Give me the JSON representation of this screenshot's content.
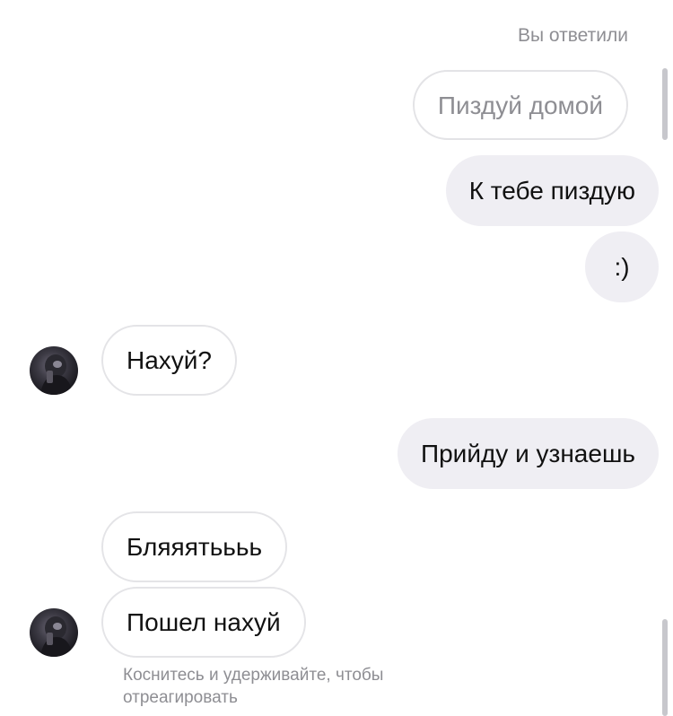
{
  "reply_label": "Вы ответили",
  "messages": [
    {
      "id": "m1",
      "direction": "quoted",
      "text": "Пиздуй домой"
    },
    {
      "id": "m2",
      "direction": "outgoing",
      "text": "К тебе пиздую"
    },
    {
      "id": "m3",
      "direction": "outgoing",
      "text": ":)"
    },
    {
      "id": "m4",
      "direction": "incoming",
      "text": "Нахуй?"
    },
    {
      "id": "m5",
      "direction": "outgoing",
      "text": "Прийду и узнаешь"
    },
    {
      "id": "m6",
      "direction": "incoming",
      "text": "Бляяятьььь"
    },
    {
      "id": "m7",
      "direction": "incoming",
      "text": "Пошел нахуй"
    }
  ],
  "hint": "Коснитесь и удерживайте, чтобы отреагировать",
  "colors": {
    "outgoing_bubble": "#efeef3",
    "incoming_border": "#e4e4e7",
    "secondary_text": "#8e8e93"
  }
}
